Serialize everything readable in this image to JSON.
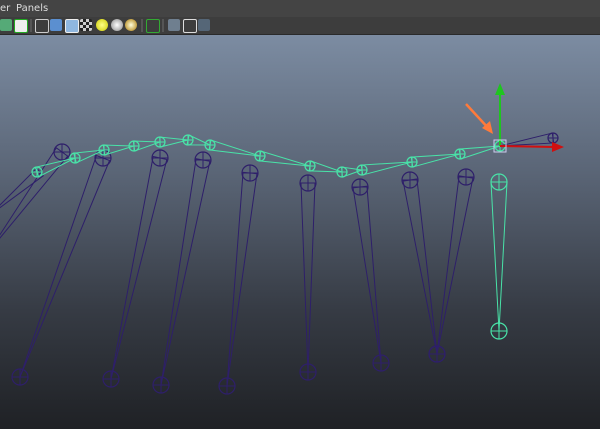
{
  "menubar": {
    "items": [
      "er",
      "Panels"
    ]
  },
  "toolbar": {
    "icons": [
      "uv-icon",
      "text-icon",
      "wireframe-cube-icon",
      "smooth-shade-icon",
      "shade-wireframe-icon",
      "textured-icon",
      "default-light-icon",
      "all-lights-icon",
      "shadow-icon",
      "isolate-select-icon",
      "xray-icon",
      "xray-joints-icon",
      "joint-display-icon"
    ]
  },
  "colors": {
    "selected_joint": "#49e3a8",
    "unselected_joint": "#2e1f6a",
    "arrow": "#ff7a3a",
    "y_axis": "#1fc51f",
    "x_axis": "#d01010"
  }
}
